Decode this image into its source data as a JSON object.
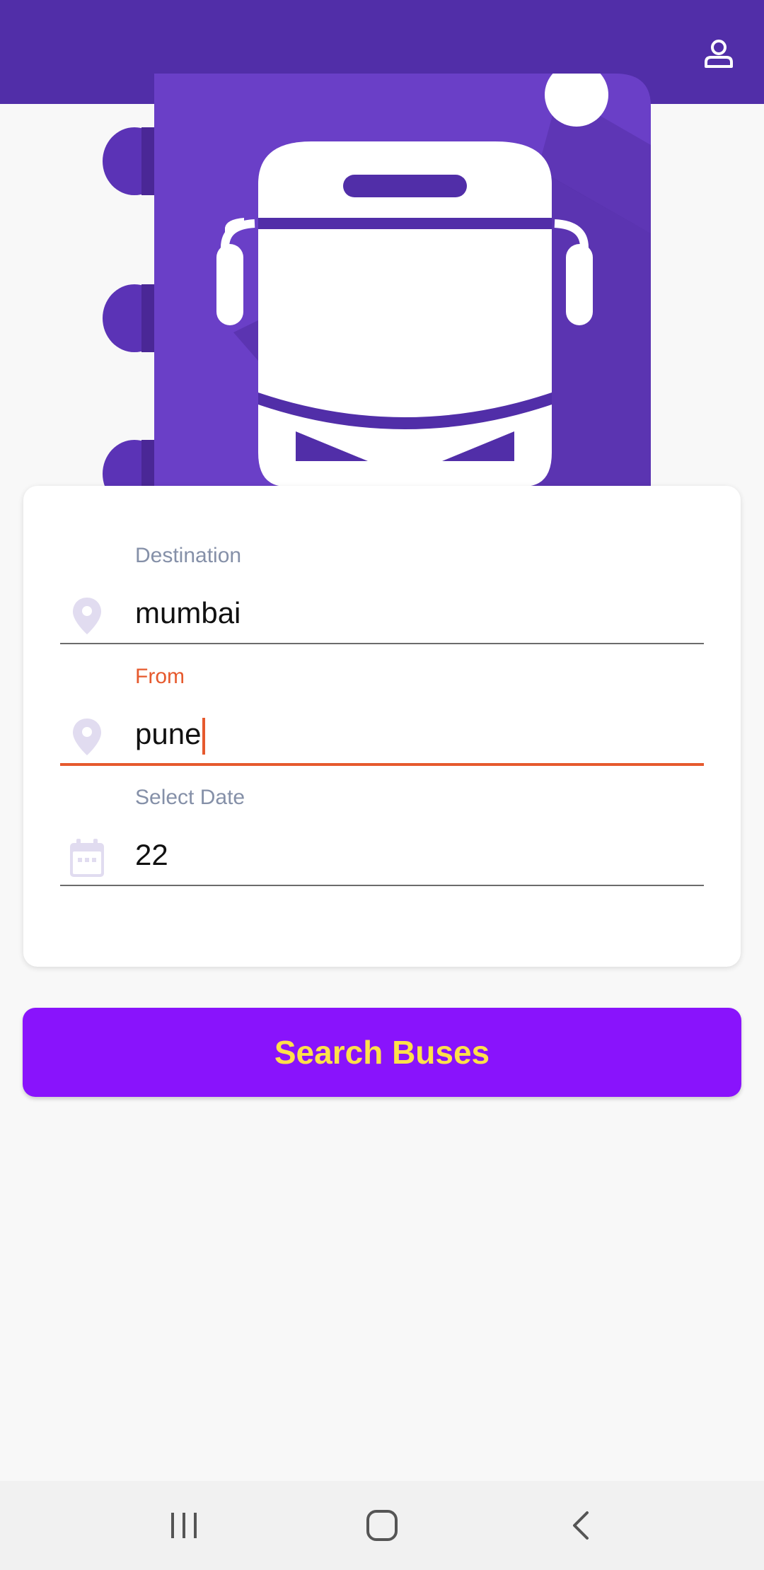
{
  "app": {
    "colors": {
      "appbar": "#512ea8",
      "accent": "#e65a2e",
      "button": "#8913fc",
      "button_text": "#ffe04a"
    }
  },
  "header": {
    "profile_icon": "person-outline-icon"
  },
  "hero": {
    "icon": "bus-ticket-illustration"
  },
  "form": {
    "destination": {
      "label": "Destination",
      "value": "mumbai",
      "icon": "map-pin-icon"
    },
    "from": {
      "label": "From",
      "value": "pune",
      "icon": "map-pin-icon",
      "focused": true
    },
    "date": {
      "label": "Select Date",
      "value": "22",
      "icon": "calendar-icon"
    }
  },
  "actions": {
    "search_label": "Search Buses"
  },
  "navbar": {
    "recents_icon": "recents-icon",
    "home_icon": "home-icon",
    "back_icon": "back-icon"
  }
}
